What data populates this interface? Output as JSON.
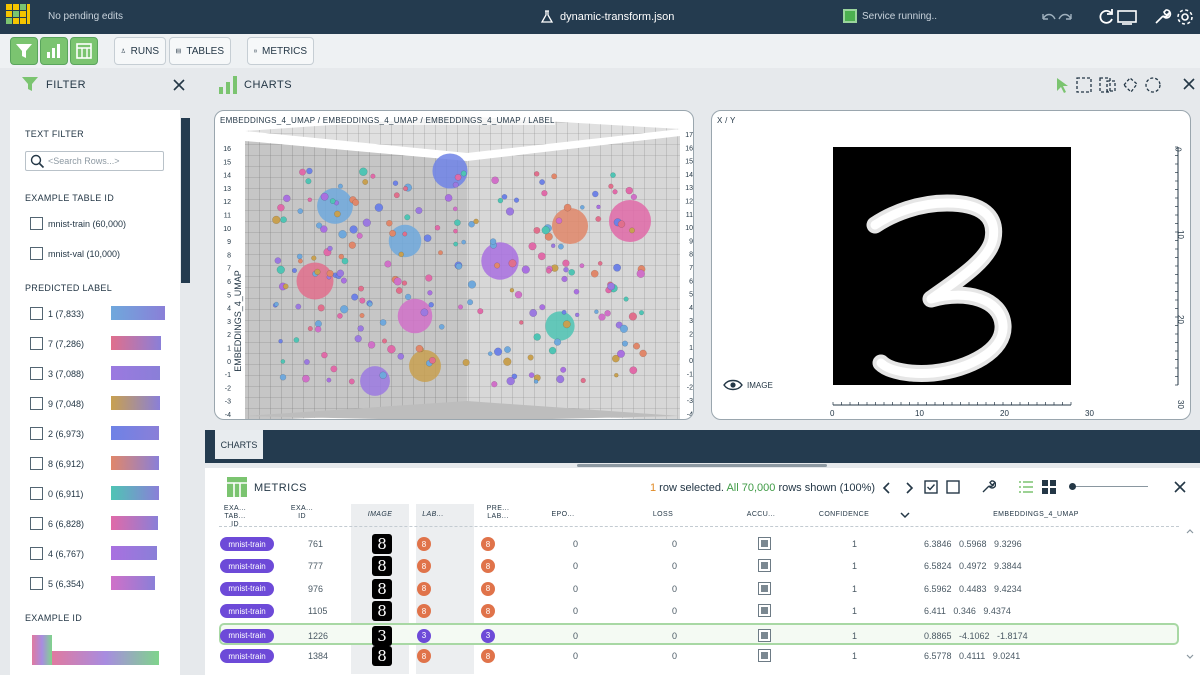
{
  "topbar": {
    "pending_text": "No pending edits",
    "dataset_name": "dynamic-transform.json",
    "service_status": "Service running.."
  },
  "toolbar": {
    "runs_label": "RUNS",
    "tables_label": "TABLES",
    "metrics_label": "METRICS"
  },
  "filter": {
    "title": "FILTER",
    "text_filter_label": "TEXT FILTER",
    "search_placeholder": "<Search Rows...>",
    "table_id_label": "EXAMPLE TABLE ID",
    "tables": [
      {
        "label": "mnist-train (60,000)"
      },
      {
        "label": "mnist-val (10,000)"
      }
    ],
    "predicted_label_title": "PREDICTED LABEL",
    "predicted_labels": [
      {
        "label": "1 (7,833)",
        "color": "#6fa8dc",
        "fill": 1.0
      },
      {
        "label": "7 (7,286)",
        "color": "#e06f8c",
        "fill": 0.93
      },
      {
        "label": "3 (7,088)",
        "color": "#9b79e0",
        "fill": 0.9
      },
      {
        "label": "9 (7,048)",
        "color": "#c8a050",
        "fill": 0.9
      },
      {
        "label": "2 (6,973)",
        "color": "#6e82e6",
        "fill": 0.89
      },
      {
        "label": "8 (6,912)",
        "color": "#e0876a",
        "fill": 0.88
      },
      {
        "label": "0 (6,911)",
        "color": "#4fc4b4",
        "fill": 0.88
      },
      {
        "label": "6 (6,828)",
        "color": "#e06aa8",
        "fill": 0.87
      },
      {
        "label": "4 (6,767)",
        "color": "#a970e0",
        "fill": 0.86
      },
      {
        "label": "5 (6,354)",
        "color": "#d070c8",
        "fill": 0.81
      }
    ],
    "example_id_label": "EXAMPLE ID"
  },
  "charts": {
    "title": "CHARTS",
    "scatter_title": "EMBEDDINGS_4_UMAP / EMBEDDINGS_4_UMAP / EMBEDDINGS_4_UMAP / LABEL",
    "scatter_ylabel": "EMBEDDINGS_4_UMAP",
    "scatter_ticks": [
      "16",
      "15",
      "14",
      "13",
      "12",
      "11",
      "10",
      "9",
      "8",
      "7",
      "6",
      "5",
      "4",
      "3",
      "2",
      "1",
      "0",
      "-1",
      "-2",
      "-3",
      "-4"
    ],
    "scatter_ticks_right": [
      "17",
      "16",
      "15",
      "14",
      "13",
      "12",
      "11",
      "10",
      "9",
      "8",
      "7",
      "6",
      "5",
      "4",
      "3",
      "2",
      "1",
      "0",
      "-1",
      "-2",
      "-3",
      "-4"
    ],
    "image_title": "X / Y",
    "image_label": "IMAGE",
    "image_x_ticks": [
      "0",
      "10",
      "20",
      "30"
    ],
    "image_y_ticks": [
      "0",
      "10",
      "20",
      "30"
    ],
    "tab_label": "CHARTS"
  },
  "metrics": {
    "title": "METRICS",
    "selected_count": "1",
    "selected_text": " row selected. ",
    "shown_all": "All 70,000",
    "shown_text": " rows shown (100%)",
    "columns": {
      "table_id": "EXA...\nTAB...\nID",
      "example_id": "EXA...\nID",
      "image": "IMAGE",
      "label": "LAB...",
      "predicted_label": "PRE...\nLAB...",
      "epoch": "EPO...",
      "loss": "LOSS",
      "accuracy": "ACCU...",
      "confidence": "CONFIDENCE",
      "embeddings": "EMBEDDINGS_4_UMAP"
    },
    "rows": [
      {
        "table": "mnist-train",
        "example_id": "761",
        "digit": "8",
        "label": "8",
        "pred": "8",
        "epoch": "0",
        "loss": "0",
        "confidence": "1",
        "embedding": "6.3846   0.5968   9.3296",
        "selected": false
      },
      {
        "table": "mnist-train",
        "example_id": "777",
        "digit": "8",
        "label": "8",
        "pred": "8",
        "epoch": "0",
        "loss": "0",
        "confidence": "1",
        "embedding": "6.5824   0.4972   9.3844",
        "selected": false
      },
      {
        "table": "mnist-train",
        "example_id": "976",
        "digit": "8",
        "label": "8",
        "pred": "8",
        "epoch": "0",
        "loss": "0",
        "confidence": "1",
        "embedding": "6.5962   0.4483   9.4234",
        "selected": false
      },
      {
        "table": "mnist-train",
        "example_id": "1105",
        "digit": "8",
        "label": "8",
        "pred": "8",
        "epoch": "0",
        "loss": "0",
        "confidence": "1",
        "embedding": "6.411   0.346   9.4374",
        "selected": false
      },
      {
        "table": "mnist-train",
        "example_id": "1226",
        "digit": "3",
        "label": "3",
        "pred": "3",
        "epoch": "0",
        "loss": "0",
        "confidence": "1",
        "embedding": "0.8865   -4.1062   -1.8174",
        "selected": true
      },
      {
        "table": "mnist-train",
        "example_id": "1384",
        "digit": "8",
        "label": "8",
        "pred": "8",
        "epoch": "0",
        "loss": "0",
        "confidence": "1",
        "embedding": "6.5778   0.4111   9.0241",
        "selected": false
      }
    ]
  },
  "colors": {
    "topbar": "#243b4f",
    "label_8": "#e0734a",
    "label_3": "#6d4ad8",
    "accent_green": "#7bc470"
  }
}
